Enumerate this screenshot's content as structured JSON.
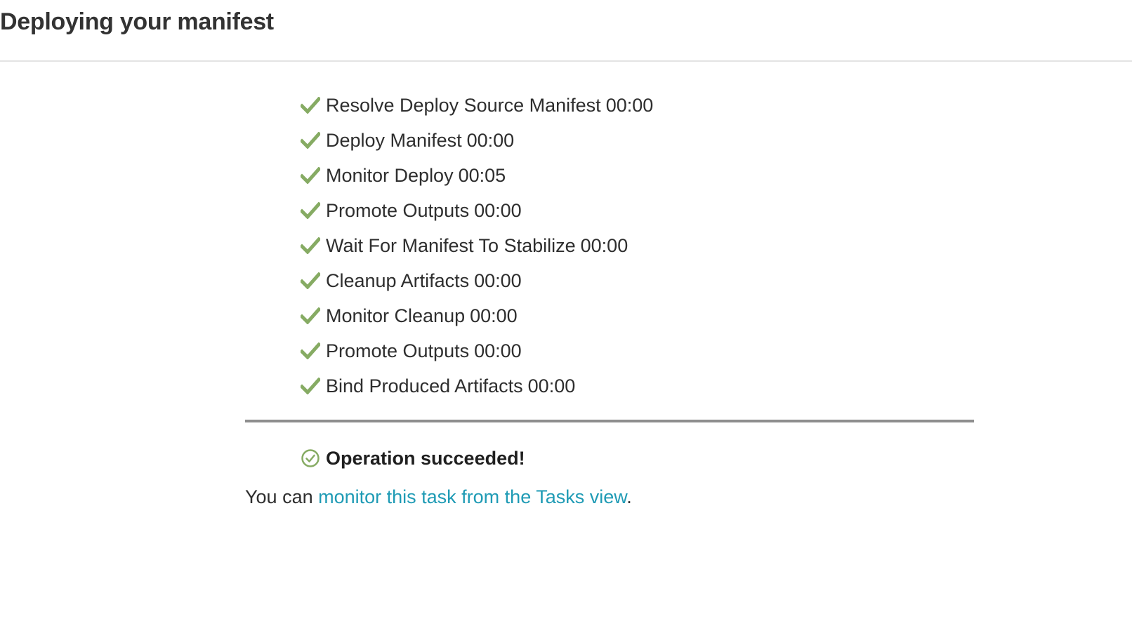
{
  "modal": {
    "title": "Deploying your manifest"
  },
  "steps": [
    {
      "name": "Resolve Deploy Source Manifest",
      "duration": "00:00",
      "status": "complete"
    },
    {
      "name": "Deploy Manifest",
      "duration": "00:00",
      "status": "complete"
    },
    {
      "name": "Monitor Deploy",
      "duration": "00:05",
      "status": "complete"
    },
    {
      "name": "Promote Outputs",
      "duration": "00:00",
      "status": "complete"
    },
    {
      "name": "Wait For Manifest To Stabilize",
      "duration": "00:00",
      "status": "complete"
    },
    {
      "name": "Cleanup Artifacts",
      "duration": "00:00",
      "status": "complete"
    },
    {
      "name": "Monitor Cleanup",
      "duration": "00:00",
      "status": "complete"
    },
    {
      "name": "Promote Outputs",
      "duration": "00:00",
      "status": "complete"
    },
    {
      "name": "Bind Produced Artifacts",
      "duration": "00:00",
      "status": "complete"
    }
  ],
  "result": {
    "status_text": "Operation succeeded!",
    "icon": "check-circle-icon"
  },
  "monitor": {
    "prefix": "You can ",
    "link_text": "monitor this task from the Tasks view",
    "suffix": "."
  },
  "colors": {
    "success_green": "#86ab63",
    "link": "#1f9bb5",
    "divider": "#8e8e8e"
  },
  "icons": {
    "step": "check-icon",
    "result": "check-circle-icon"
  }
}
